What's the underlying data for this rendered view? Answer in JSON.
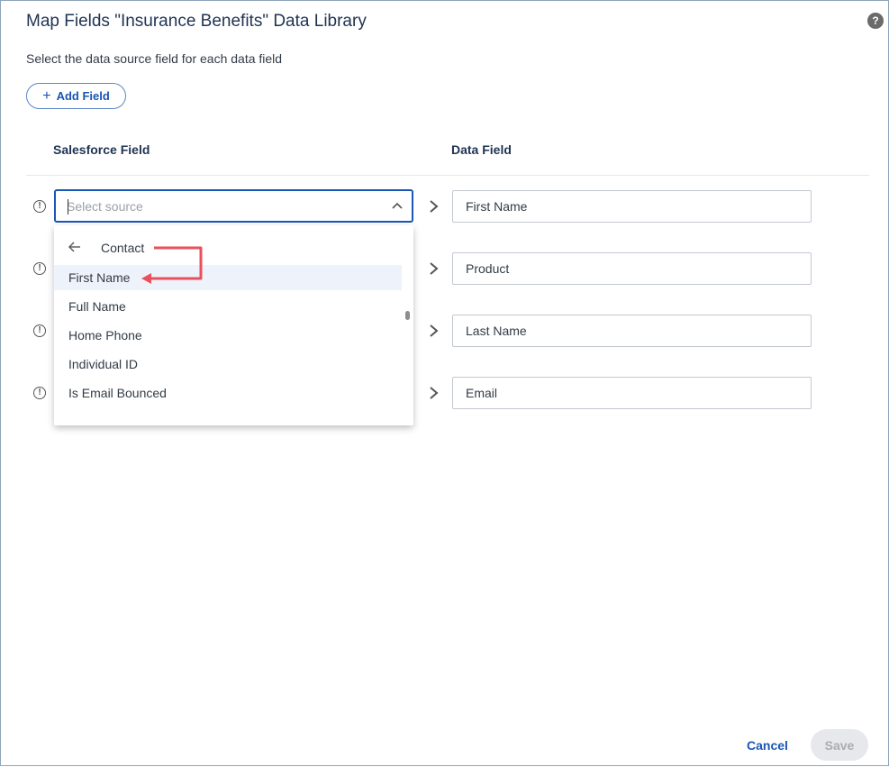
{
  "dialog": {
    "title": "Map Fields \"Insurance Benefits\" Data Library",
    "subtitle": "Select the data source field for each data field",
    "help_icon": "?",
    "add_field_label": "Add Field",
    "add_field_icon": "+"
  },
  "columns": {
    "salesforce_field": "Salesforce Field",
    "data_field": "Data Field"
  },
  "source_select": {
    "placeholder": "Select source",
    "value": ""
  },
  "dropdown": {
    "group_label": "Contact",
    "items": [
      {
        "label": "First Name",
        "highlighted": true
      },
      {
        "label": "Full Name",
        "highlighted": false
      },
      {
        "label": "Home Phone",
        "highlighted": false
      },
      {
        "label": "Individual ID",
        "highlighted": false
      },
      {
        "label": "Is Email Bounced",
        "highlighted": false
      }
    ]
  },
  "rows": [
    {
      "warning_icon": "!",
      "data_field": "First Name"
    },
    {
      "warning_icon": "!",
      "data_field": "Product"
    },
    {
      "warning_icon": "!",
      "data_field": "Last Name"
    },
    {
      "warning_icon": "!",
      "data_field": "Email"
    }
  ],
  "footer": {
    "cancel_label": "Cancel",
    "save_label": "Save"
  },
  "colors": {
    "accent": "#1a56b4",
    "annotation_arrow": "#e8505b"
  }
}
